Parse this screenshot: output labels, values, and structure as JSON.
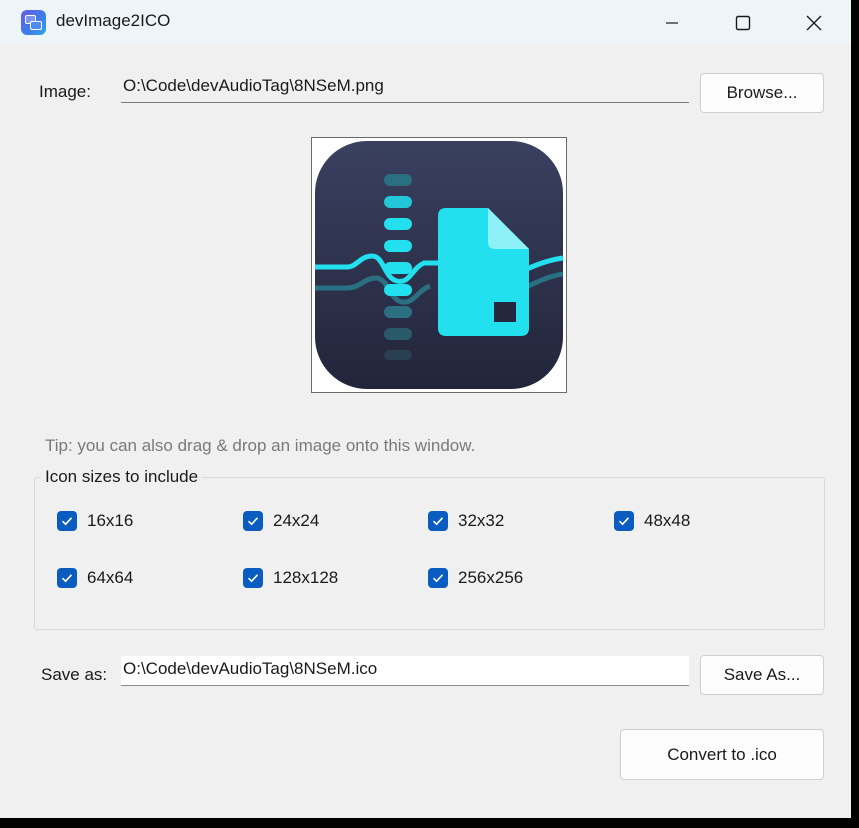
{
  "window": {
    "title": "devImage2ICO"
  },
  "image": {
    "label": "Image:",
    "path": "O:\\Code\\devAudioTag\\8NSeM.png",
    "browse_label": "Browse..."
  },
  "tip": "Tip: you can also drag & drop an image onto this window.",
  "sizes": {
    "title": "Icon sizes to include",
    "items": [
      {
        "label": "16x16",
        "checked": true
      },
      {
        "label": "24x24",
        "checked": true
      },
      {
        "label": "32x32",
        "checked": true
      },
      {
        "label": "48x48",
        "checked": true
      },
      {
        "label": "64x64",
        "checked": true
      },
      {
        "label": "128x128",
        "checked": true
      },
      {
        "label": "256x256",
        "checked": true
      }
    ]
  },
  "save": {
    "label": "Save as:",
    "path": "O:\\Code\\devAudioTag\\8NSeM.ico",
    "save_as_label": "Save As..."
  },
  "convert_label": "Convert to .ico",
  "colors": {
    "checkbox_accent": "#0a5cc0",
    "titlebar_bg": "#eef5f8",
    "preview_icon_bg": "#2b2f47",
    "preview_icon_accent": "#22e0ee"
  }
}
